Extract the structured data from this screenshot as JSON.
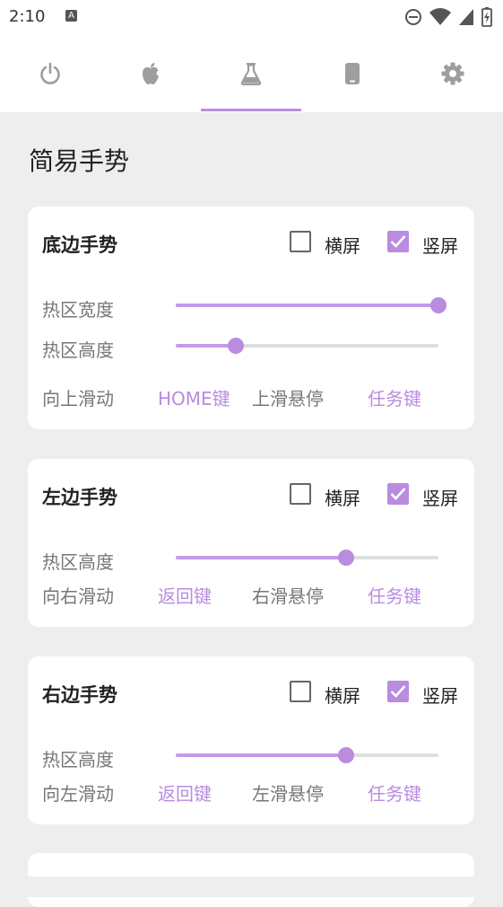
{
  "status_bar": {
    "time": "2:10",
    "notification_letter": "A"
  },
  "tabs": [
    {
      "icon": "power-icon",
      "selected": false
    },
    {
      "icon": "apple-icon",
      "selected": false
    },
    {
      "icon": "flask-icon",
      "selected": true
    },
    {
      "icon": "phone-icon",
      "selected": false
    },
    {
      "icon": "gear-icon",
      "selected": false
    }
  ],
  "accent_color": "#b98ce0",
  "section_title": "简易手势",
  "cards": {
    "bottom": {
      "title": "底边手势",
      "landscape_label": "横屏",
      "landscape_checked": false,
      "portrait_label": "竖屏",
      "portrait_checked": true,
      "hotzone_width_label": "热区宽度",
      "hotzone_width_value": 1.0,
      "hotzone_height_label": "热区高度",
      "hotzone_height_value": 0.23,
      "swipe_label": "向上滑动",
      "swipe_action": "HOME键",
      "hover_label": "上滑悬停",
      "hover_action": "任务键"
    },
    "left": {
      "title": "左边手势",
      "landscape_label": "横屏",
      "landscape_checked": false,
      "portrait_label": "竖屏",
      "portrait_checked": true,
      "hotzone_height_label": "热区高度",
      "hotzone_height_value": 0.65,
      "swipe_label": "向右滑动",
      "swipe_action": "返回键",
      "hover_label": "右滑悬停",
      "hover_action": "任务键"
    },
    "right": {
      "title": "右边手势",
      "landscape_label": "横屏",
      "landscape_checked": false,
      "portrait_label": "竖屏",
      "portrait_checked": true,
      "hotzone_height_label": "热区高度",
      "hotzone_height_value": 0.65,
      "swipe_label": "向左滑动",
      "swipe_action": "返回键",
      "hover_label": "左滑悬停",
      "hover_action": "任务键"
    }
  }
}
